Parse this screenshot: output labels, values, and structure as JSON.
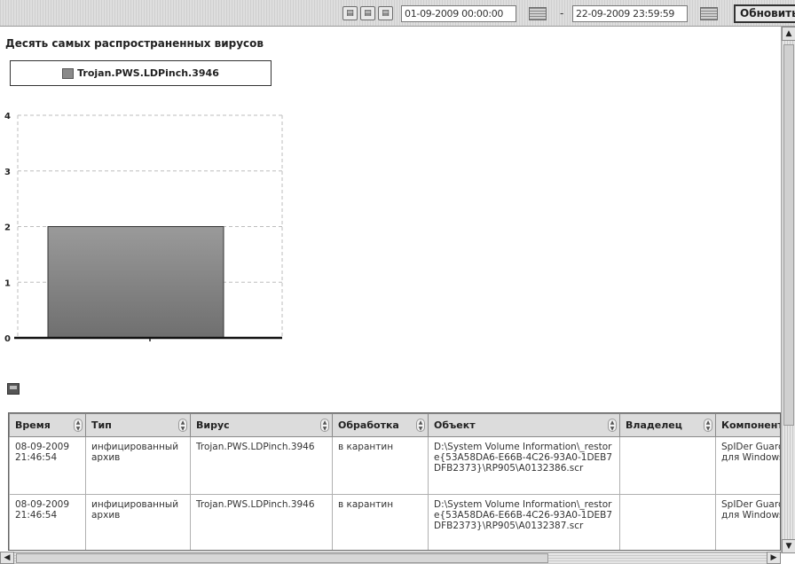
{
  "toolbar": {
    "date_from": "01-09-2009 00:00:00",
    "date_to": "22-09-2009 23:59:59",
    "separator": "-",
    "refresh_label": "Обновить"
  },
  "section_title": "Десять самых распространенных вирусов",
  "chart_data": {
    "type": "bar",
    "categories": [
      ""
    ],
    "series": [
      {
        "name": "Trojan.PWS.LDPinch.3946",
        "values": [
          2
        ]
      }
    ],
    "ylim": [
      0,
      4
    ],
    "yticks": [
      "0",
      "1",
      "2",
      "3",
      "4"
    ],
    "grid": true,
    "legend": "top-left",
    "colors": {
      "bar": "#8c8c8c",
      "bar_shade": "#6f6f6f",
      "grid": "#bdbdbd"
    }
  },
  "table": {
    "columns": [
      "Время",
      "Тип",
      "Вирус",
      "Обработка",
      "Объект",
      "Владелец",
      "Компонент"
    ],
    "rows": [
      {
        "time": "08-09-2009 21:46:54",
        "type": "инфицированный архив",
        "virus": "Trojan.PWS.LDPinch.3946",
        "action": "в карантин",
        "object": "D:\\System Volume Information\\_restore{53A58DA6-E66B-4C26-93A0-1DEB7DFB2373}\\RP905\\A0132386.scr",
        "owner": "",
        "component": "SpIDer Guard для Windows XP"
      },
      {
        "time": "08-09-2009 21:46:54",
        "type": "инфицированный архив",
        "virus": "Trojan.PWS.LDPinch.3946",
        "action": "в карантин",
        "object": "D:\\System Volume Information\\_restore{53A58DA6-E66B-4C26-93A0-1DEB7DFB2373}\\RP905\\A0132387.scr",
        "owner": "",
        "component": "SpIDer Guard для Windows XP"
      }
    ]
  }
}
